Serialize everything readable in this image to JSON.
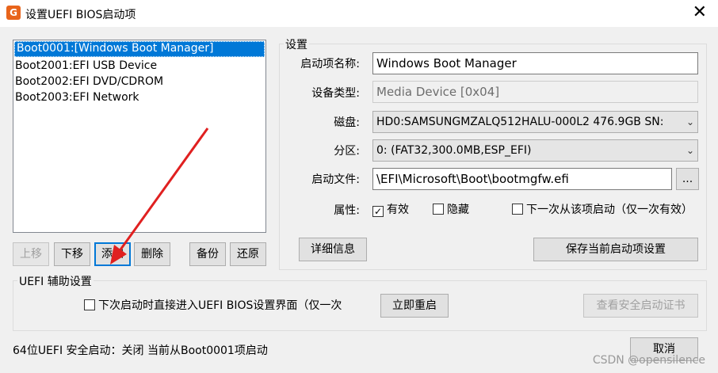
{
  "window": {
    "title": "设置UEFI BIOS启动项",
    "app_icon_letter": "G",
    "close_glyph": "✕"
  },
  "boot_list": [
    "Boot0001:[Windows Boot Manager]",
    "Boot2001:EFI USB Device",
    "Boot2002:EFI DVD/CDROM",
    "Boot2003:EFI Network"
  ],
  "list_buttons": {
    "up": "上移",
    "down": "下移",
    "add": "添加",
    "delete": "删除",
    "backup": "备份",
    "restore": "还原"
  },
  "settings": {
    "group_title": "设置",
    "name_label": "启动项名称:",
    "name_value": "Windows Boot Manager",
    "device_type_label": "设备类型:",
    "device_type_value": "Media Device [0x04]",
    "disk_label": "磁盘:",
    "disk_value": "HD0:SAMSUNGMZALQ512HALU-000L2 476.9GB SN:",
    "partition_label": "分区:",
    "partition_value": "0: (FAT32,300.0MB,ESP_EFI)",
    "boot_file_label": "启动文件:",
    "boot_file_value": "\\EFI\\Microsoft\\Boot\\bootmgfw.efi",
    "browse_label": "...",
    "attr_label": "属性:",
    "attr_valid": "有效",
    "attr_hidden": "隐藏",
    "attr_next_once": "下一次从该项启动（仅一次有效）",
    "details_button": "详细信息",
    "save_button": "保存当前启动项设置"
  },
  "uefi_aux": {
    "group_title": "UEFI 辅助设置",
    "enter_bios_checkbox": "下次启动时直接进入UEFI BIOS设置界面（仅一次",
    "restart_button": "立即重启",
    "secure_cert_button": "查看安全启动证书"
  },
  "status": {
    "text": "64位UEFI   安全启动：关闭   当前从Boot0001项启动"
  },
  "cancel_button": "取消",
  "watermark": "CSDN @opensilence",
  "colors": {
    "selection": "#0078d7",
    "arrow": "#e02020",
    "dialog_bg": "#f0f0f0"
  }
}
